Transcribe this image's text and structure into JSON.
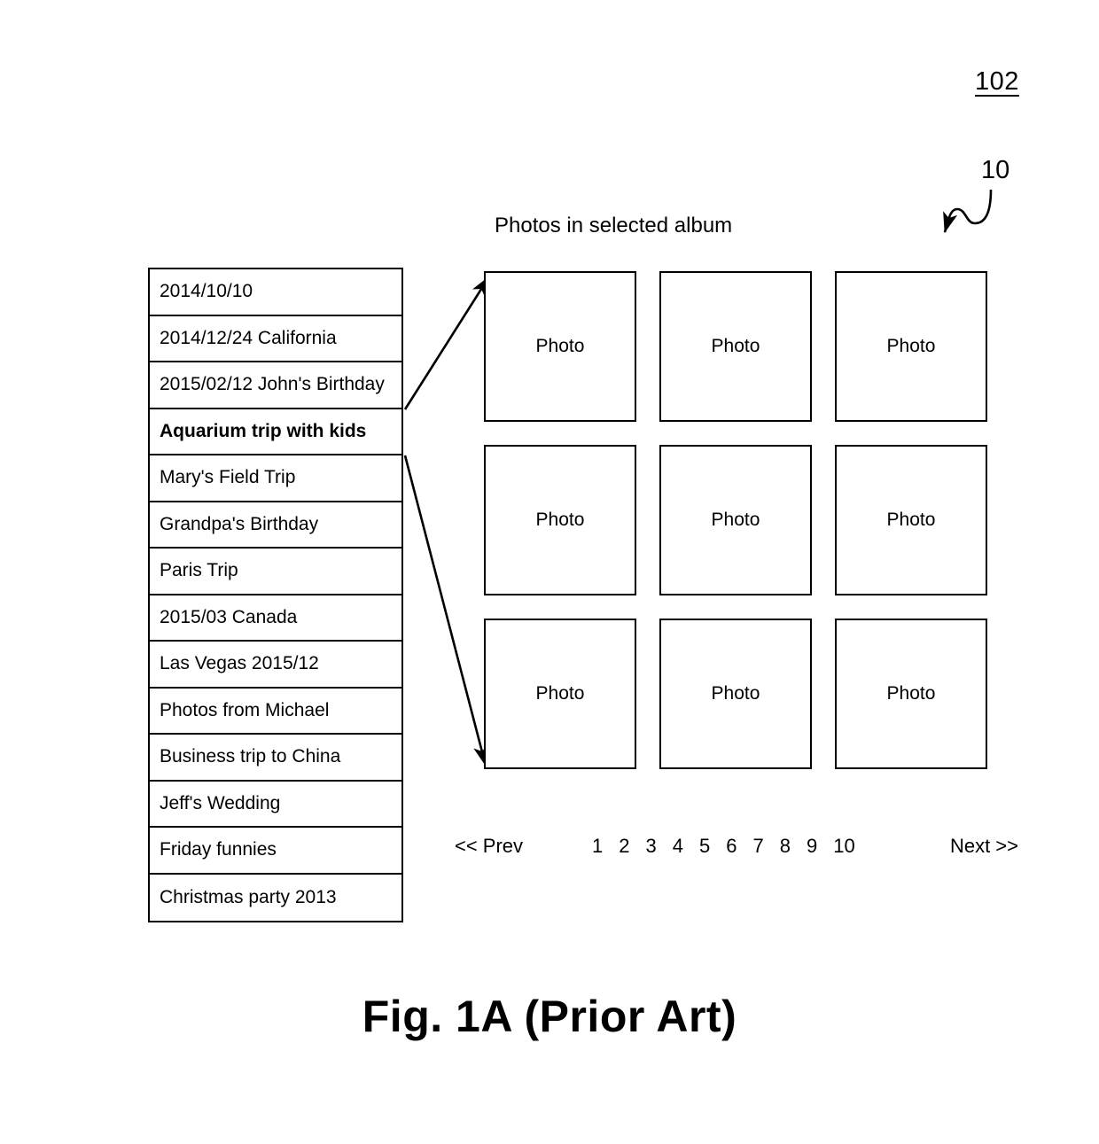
{
  "figure": {
    "caption": "Fig. 1A (Prior Art)",
    "reference_numerals": {
      "screen": "102",
      "interface": "10"
    }
  },
  "album_list": {
    "name": "album-list",
    "items": [
      {
        "label": "2014/10/10",
        "selected": false
      },
      {
        "label": "2014/12/24 California",
        "selected": false
      },
      {
        "label": "2015/02/12 John's Birthday",
        "selected": false
      },
      {
        "label": "Aquarium trip with kids",
        "selected": true
      },
      {
        "label": "Mary's Field Trip",
        "selected": false
      },
      {
        "label": "Grandpa's Birthday",
        "selected": false
      },
      {
        "label": "Paris Trip",
        "selected": false
      },
      {
        "label": "2015/03 Canada",
        "selected": false
      },
      {
        "label": "Las Vegas 2015/12",
        "selected": false
      },
      {
        "label": "Photos from Michael",
        "selected": false
      },
      {
        "label": "Business trip to China",
        "selected": false
      },
      {
        "label": "Jeff's Wedding",
        "selected": false
      },
      {
        "label": "Friday funnies",
        "selected": false
      },
      {
        "label": "Christmas party 2013",
        "selected": false
      }
    ]
  },
  "photo_pane": {
    "title": "Photos in selected album",
    "cells": [
      {
        "label": "Photo"
      },
      {
        "label": "Photo"
      },
      {
        "label": "Photo"
      },
      {
        "label": "Photo"
      },
      {
        "label": "Photo"
      },
      {
        "label": "Photo"
      },
      {
        "label": "Photo"
      },
      {
        "label": "Photo"
      },
      {
        "label": "Photo"
      }
    ]
  },
  "pagination": {
    "prev_label": "<< Prev",
    "next_label": "Next >>",
    "pages": [
      "1",
      "2",
      "3",
      "4",
      "5",
      "6",
      "7",
      "8",
      "9",
      "10"
    ]
  },
  "colors": {
    "line": "#000000",
    "background": "#ffffff"
  }
}
